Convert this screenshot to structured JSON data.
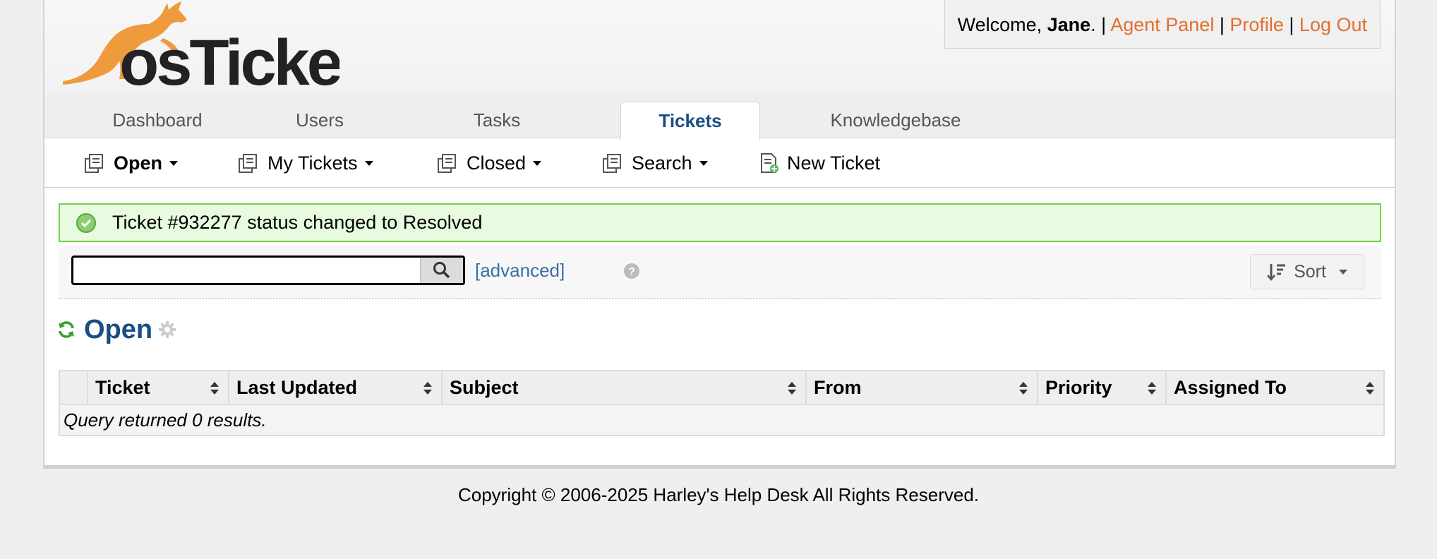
{
  "header": {
    "logo_text": "osTicket",
    "welcome_prefix": "Welcome, ",
    "user_name": "Jane",
    "welcome_suffix": ". | ",
    "agent_panel": "Agent Panel",
    "separator": " | ",
    "profile": "Profile",
    "logout": "Log Out"
  },
  "nav": {
    "tabs": [
      {
        "label": "Dashboard"
      },
      {
        "label": "Users"
      },
      {
        "label": "Tasks"
      },
      {
        "label": "Tickets",
        "active": true
      },
      {
        "label": "Knowledgebase"
      }
    ]
  },
  "subnav": {
    "items": [
      {
        "label": "Open",
        "icon": "tickets-icon",
        "dropdown": true,
        "bold": true
      },
      {
        "label": "My Tickets",
        "icon": "tickets-icon",
        "dropdown": true
      },
      {
        "label": "Closed",
        "icon": "tickets-icon",
        "dropdown": true
      },
      {
        "label": "Search",
        "icon": "tickets-icon",
        "dropdown": true
      },
      {
        "label": "New Ticket",
        "icon": "new-ticket-icon",
        "dropdown": false
      }
    ]
  },
  "message": {
    "text": "Ticket #932277 status changed to Resolved",
    "type": "success"
  },
  "search": {
    "value": "",
    "advanced_label": "[advanced]",
    "sort_label": "Sort"
  },
  "list": {
    "title": "Open",
    "columns": [
      "Ticket",
      "Last Updated",
      "Subject",
      "From",
      "Priority",
      "Assigned To"
    ],
    "empty_message": "Query returned 0 results."
  },
  "footer": {
    "copyright": "Copyright © 2006-2025 Harley's Help Desk All Rights Reserved."
  },
  "colors": {
    "link_orange": "#e36f2f",
    "title_blue": "#184e81",
    "success_bg": "#e8fbe0",
    "success_border": "#6fd24a",
    "refresh_green": "#3a9d2f"
  }
}
